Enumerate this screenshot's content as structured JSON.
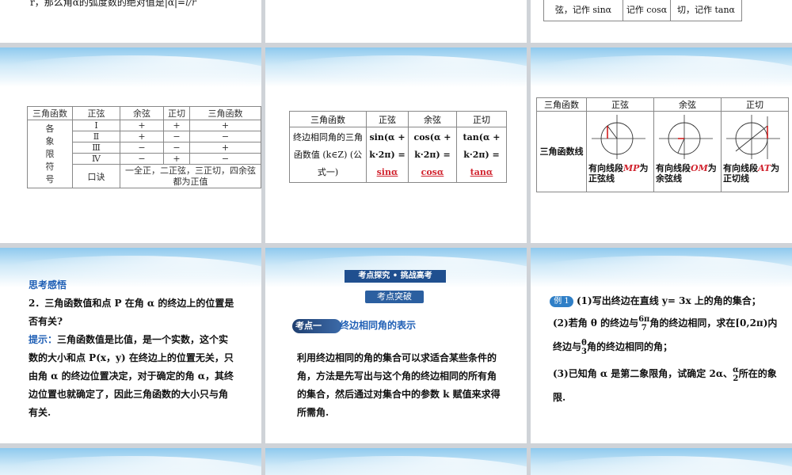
{
  "row1": {
    "left_text": "r，那么角α的弧度数的绝对值是|α|=",
    "left_frac": "l/r",
    "right_cells": [
      "弦，记作 sinα",
      "记作 cosα",
      "切，记作 tanα"
    ]
  },
  "slide_quadrant_signs": {
    "headers": [
      "三角函数",
      "正弦",
      "余弦",
      "正切",
      "三角函数"
    ],
    "row_label": "各象限符号",
    "rows": [
      {
        "q": "Ⅰ",
        "sin": "+",
        "cos": "+",
        "tan": "+"
      },
      {
        "q": "Ⅱ",
        "sin": "+",
        "cos": "−",
        "tan": "−"
      },
      {
        "q": "Ⅲ",
        "sin": "−",
        "cos": "−",
        "tan": "+"
      },
      {
        "q": "Ⅳ",
        "sin": "−",
        "cos": "+",
        "tan": "−"
      }
    ],
    "mnemonic_label": "口诀",
    "mnemonic": "一全正，二正弦，三正切，四余弦都为正值"
  },
  "slide_formula_one": {
    "headers": [
      "三角函数",
      "正弦",
      "余弦",
      "正切"
    ],
    "label": "终边相同角的三角函数值 (k∈Z) (公式一)",
    "sin": "sin(α + k·2π) =",
    "cos": "cos(α + k·2π) =",
    "tan": "tan(α + k·2π) =",
    "sin_ans": "sinα",
    "cos_ans": "cosα",
    "tan_ans": "tanα"
  },
  "slide_trig_lines": {
    "headers": [
      "三角函数",
      "正弦",
      "余弦",
      "正切"
    ],
    "row_label": "三角函数线",
    "sin_text": "有向线段",
    "sin_seg": "MP",
    "sin_tail": "为正弦线",
    "cos_text": "有向线段",
    "cos_seg": "OM",
    "cos_tail": "为余弦线",
    "tan_text": "有向线段",
    "tan_seg": "AT",
    "tan_tail": "为正切线"
  },
  "slide_thinking": {
    "title": "思考感悟",
    "question": "2．三角函数值和点 P 在角 α 的终边上的位置是否有关?",
    "hint_label": "提示：",
    "hint": "三角函数值是比值，是一个实数，这个实数的大小和点 P(x，y) 在终边上的位置无关，只由角 α 的终边位置决定，对于确定的角 α，其终边位置也就确定了，因此三角函数的大小只与角有关."
  },
  "slide_exam": {
    "banner": "考点探究 • 挑战高考",
    "sub_banner": "考点突破",
    "point_badge": "考点一",
    "point_title": "终边相同角的表示",
    "body": "利用终边相同的角的集合可以求适合某些条件的角，方法是先写出与这个角的终边相同的所有角的集合，然后通过对集合中的参数 k 赋值来求得所需角."
  },
  "slide_example": {
    "badge": "例 1",
    "q1": "(1)写出终边在直线 y= 3x 上的角的集合；",
    "q2a": "(2)若角 θ 的终边与",
    "q2_frac_num": "6π",
    "q2_frac_den": "7",
    "q2b": "角的终边相同，求在[0,2π)内终边与",
    "q2_frac2_num": "θ",
    "q2_frac2_den": "3",
    "q2c": "角的终边相同的角；",
    "q3a": "(3)已知角 α 是第二象限角，试确定 2α、",
    "q3_frac_num": "α",
    "q3_frac_den": "2",
    "q3b": "所在的象限."
  }
}
